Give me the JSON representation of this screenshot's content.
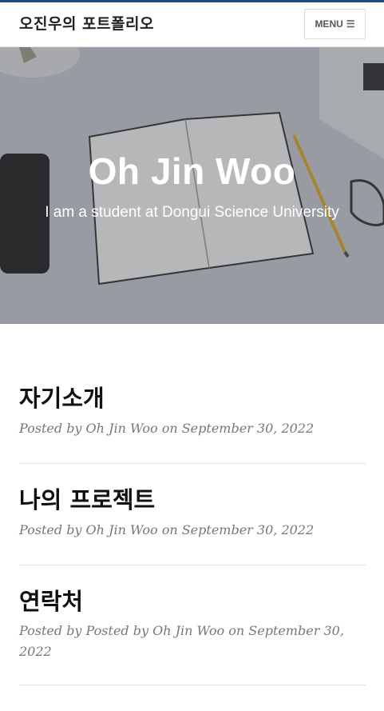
{
  "navbar": {
    "brand": "오진우의 포트폴리오",
    "menu_label": "MENU",
    "menu_icon": "hamburger-icon"
  },
  "hero": {
    "title": "Oh Jin Woo",
    "subtitle": "I am a student at Dongui Science University"
  },
  "posts": [
    {
      "title": "자기소개",
      "meta": "Posted by Oh Jin Woo on September 30, 2022"
    },
    {
      "title": "나의 프로젝트",
      "meta": "Posted by Oh Jin Woo on September 30, 2022"
    },
    {
      "title": "연락처",
      "meta": "Posted by Posted by Oh Jin Woo on September 30, 2022"
    }
  ],
  "colors": {
    "accent_line": "#1f4e79",
    "hero_overlay": "#282c34",
    "meta_text": "#777777"
  }
}
